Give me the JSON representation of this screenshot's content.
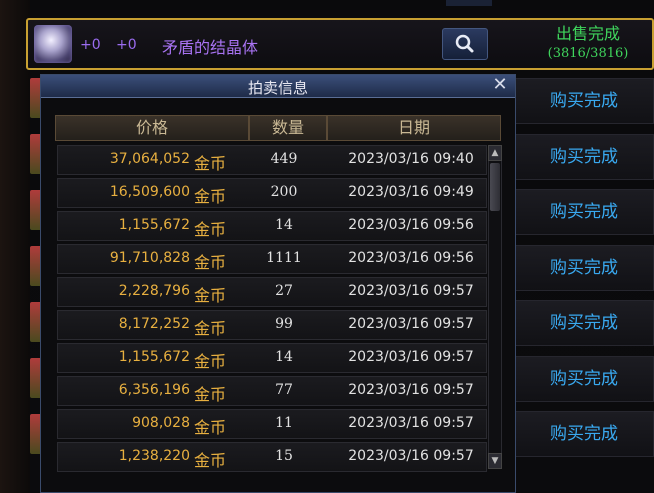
{
  "top_item": {
    "plus1": "+0",
    "plus2": "+0",
    "name": "矛盾的结晶体",
    "status": "出售完成",
    "count": "(3816/3816)"
  },
  "right_buttons": [
    "购买完成",
    "购买完成",
    "购买完成",
    "购买完成",
    "购买完成",
    "购买完成",
    "购买完成"
  ],
  "dialog": {
    "title": "拍卖信息",
    "close": "✕",
    "columns": {
      "price": "价格",
      "qty": "数量",
      "date": "日期"
    },
    "unit": "金币",
    "rows": [
      {
        "price": "37,064,052",
        "qty": "449",
        "date": "2023/03/16 09:40"
      },
      {
        "price": "16,509,600",
        "qty": "200",
        "date": "2023/03/16 09:49"
      },
      {
        "price": "1,155,672",
        "qty": "14",
        "date": "2023/03/16 09:56"
      },
      {
        "price": "91,710,828",
        "qty": "1111",
        "date": "2023/03/16 09:56"
      },
      {
        "price": "2,228,796",
        "qty": "27",
        "date": "2023/03/16 09:57"
      },
      {
        "price": "8,172,252",
        "qty": "99",
        "date": "2023/03/16 09:57"
      },
      {
        "price": "1,155,672",
        "qty": "14",
        "date": "2023/03/16 09:57"
      },
      {
        "price": "6,356,196",
        "qty": "77",
        "date": "2023/03/16 09:57"
      },
      {
        "price": "908,028",
        "qty": "11",
        "date": "2023/03/16 09:57"
      },
      {
        "price": "1,238,220",
        "qty": "15",
        "date": "2023/03/16 09:57"
      }
    ]
  },
  "colors": {
    "gold": "#e8b040",
    "green": "#3fd45c",
    "blue": "#39a9f0",
    "purple": "#a873f2"
  }
}
